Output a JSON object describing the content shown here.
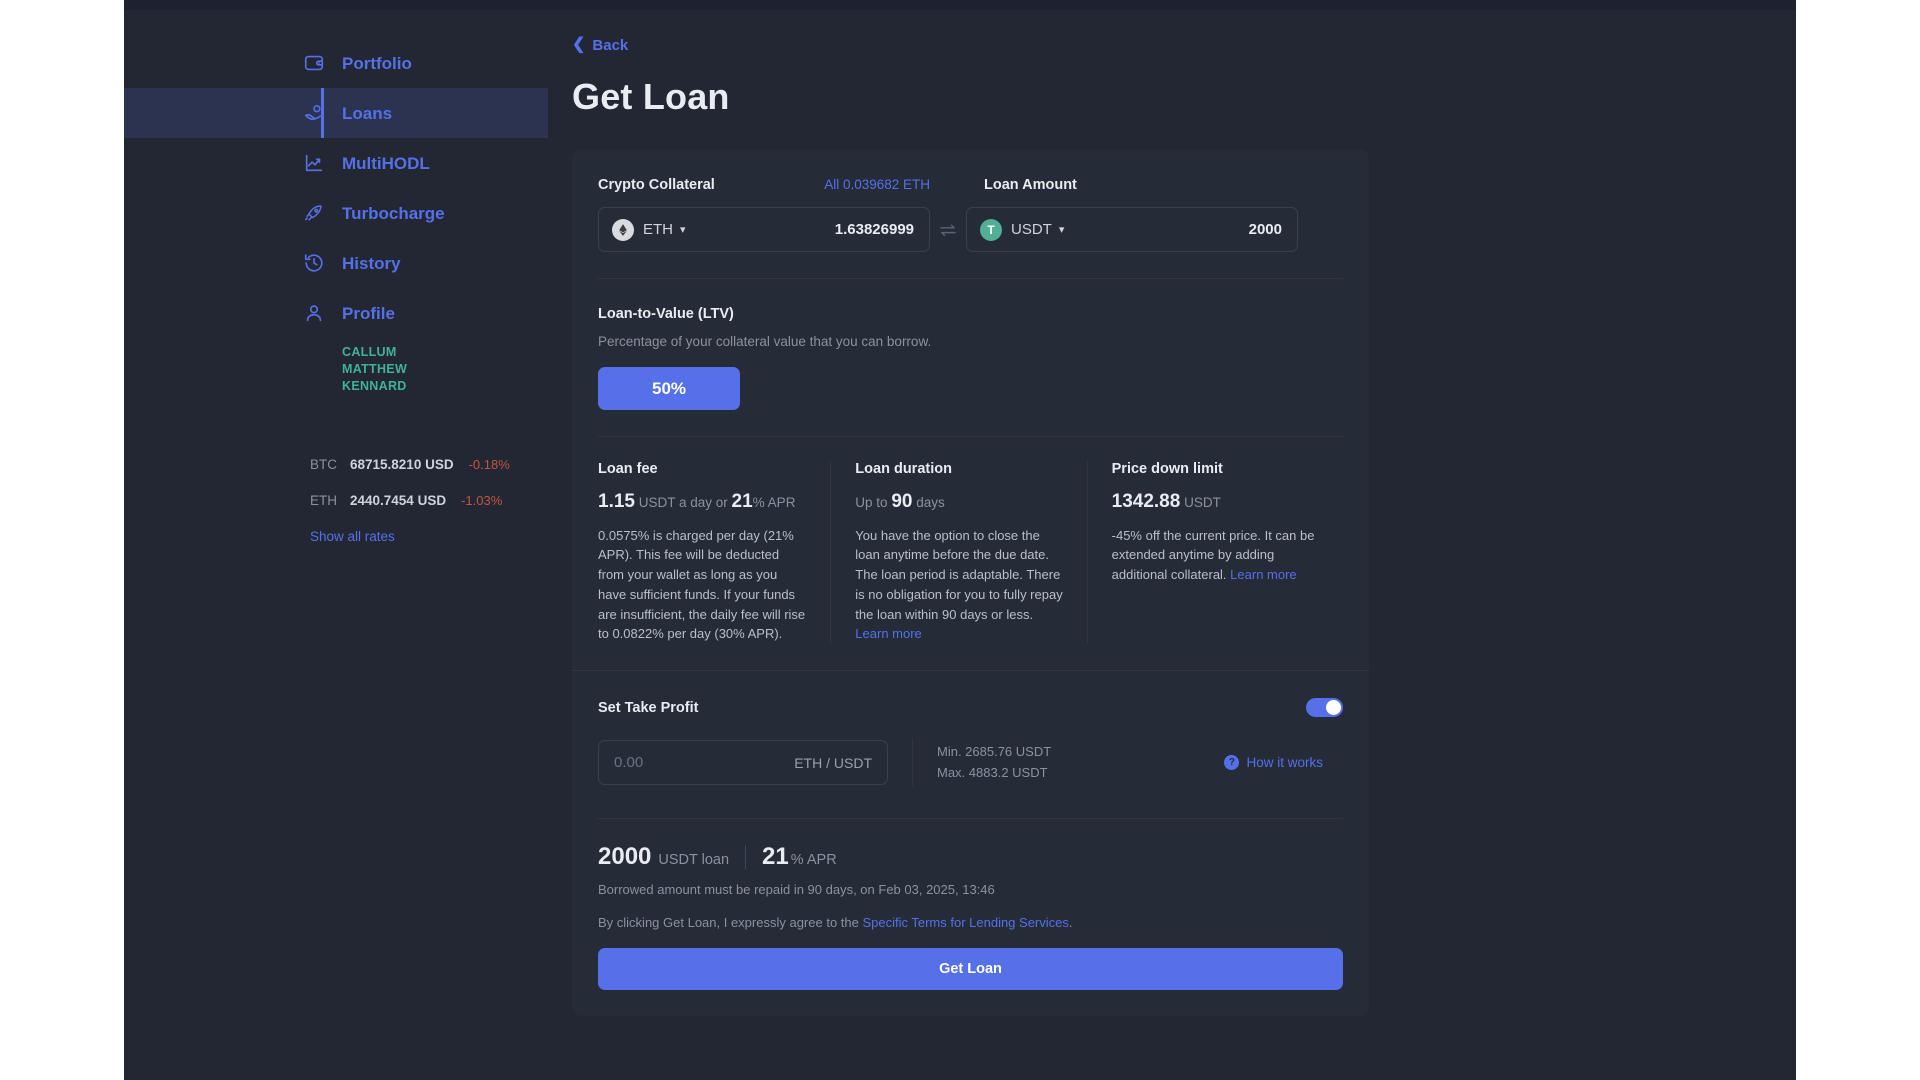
{
  "sidebar": {
    "items": [
      {
        "label": "Portfolio",
        "icon": "wallet-icon",
        "active": false
      },
      {
        "label": "Loans",
        "icon": "loans-hand-icon",
        "active": true
      },
      {
        "label": "MultiHODL",
        "icon": "chart-up-icon",
        "active": false
      },
      {
        "label": "Turbocharge",
        "icon": "rocket-icon",
        "active": false
      },
      {
        "label": "History",
        "icon": "clock-history-icon",
        "active": false
      },
      {
        "label": "Profile",
        "icon": "user-icon",
        "active": false
      }
    ],
    "username": "CALLUM MATTHEW KENNARD",
    "rates": [
      {
        "symbol": "BTC",
        "value": "68715.8210 USD",
        "change": "-0.18%"
      },
      {
        "symbol": "ETH",
        "value": "2440.7454 USD",
        "change": "-1.03%"
      }
    ],
    "show_all_rates": "Show all rates"
  },
  "header": {
    "back_label": "Back",
    "title": "Get Loan"
  },
  "collateral": {
    "title": "Crypto Collateral",
    "all_link": "All 0.039682 ETH",
    "coin_symbol": "ETH",
    "coin_glyph": "⧫",
    "amount": "1.63826999"
  },
  "loan_amount": {
    "title": "Loan Amount",
    "coin_symbol": "USDT",
    "coin_glyph": "T",
    "amount": "2000"
  },
  "ltv": {
    "title": "Loan-to-Value (LTV)",
    "description": "Percentage of your collateral value that you can borrow.",
    "selected": "50%"
  },
  "columns": [
    {
      "heading": "Loan fee",
      "value_prefix": "1.15",
      "value_mid": " USDT a day or ",
      "value_suffix": "21",
      "value_tail": "% APR",
      "body": "0.0575% is charged per day (21% APR). This fee will be deducted from your wallet as long as you have sufficient funds. If your funds are insufficient, the daily fee will rise to 0.0822% per day (30% APR).",
      "link": ""
    },
    {
      "heading": "Loan duration",
      "value_prefix": "Up to ",
      "value_mid": "90",
      "value_suffix": " days",
      "value_tail": "",
      "body": "You have the option to close the loan anytime before the due date. The loan period is adaptable. There is no obligation for you to fully repay the loan within 90 days or less. ",
      "link": "Learn more"
    },
    {
      "heading": "Price down limit",
      "value_prefix": "1342.88",
      "value_mid": " USDT",
      "value_suffix": "",
      "value_tail": "",
      "body": "-45% off the current price. It can be extended anytime by adding additional collateral. ",
      "link": "Learn more"
    }
  ],
  "take_profit": {
    "title": "Set Take Profit",
    "toggle_on": true,
    "input_placeholder": "0.00",
    "input_value": "",
    "input_unit": "ETH / USDT",
    "min_label": "Min. 2685.76 USDT",
    "max_label": "Max. 4883.2 USDT",
    "how_it_works": "How it works",
    "help_glyph": "?"
  },
  "summary": {
    "amount": "2000",
    "amount_unit": "USDT loan",
    "apr": "21",
    "apr_unit": "% APR",
    "repay_note": "Borrowed amount must be repaid in 90 days, on Feb 03, 2025, 13:46",
    "terms_prefix": "By clicking Get Loan, I expressly agree to the ",
    "terms_link": "Specific Terms for Lending Services",
    "terms_suffix": ".",
    "cta_label": "Get Loan"
  },
  "colors": {
    "accent": "#5570e8",
    "app_bg": "#232733",
    "card_bg": "#262b38",
    "username": "#3fb39a",
    "negative": "#c0563f"
  }
}
